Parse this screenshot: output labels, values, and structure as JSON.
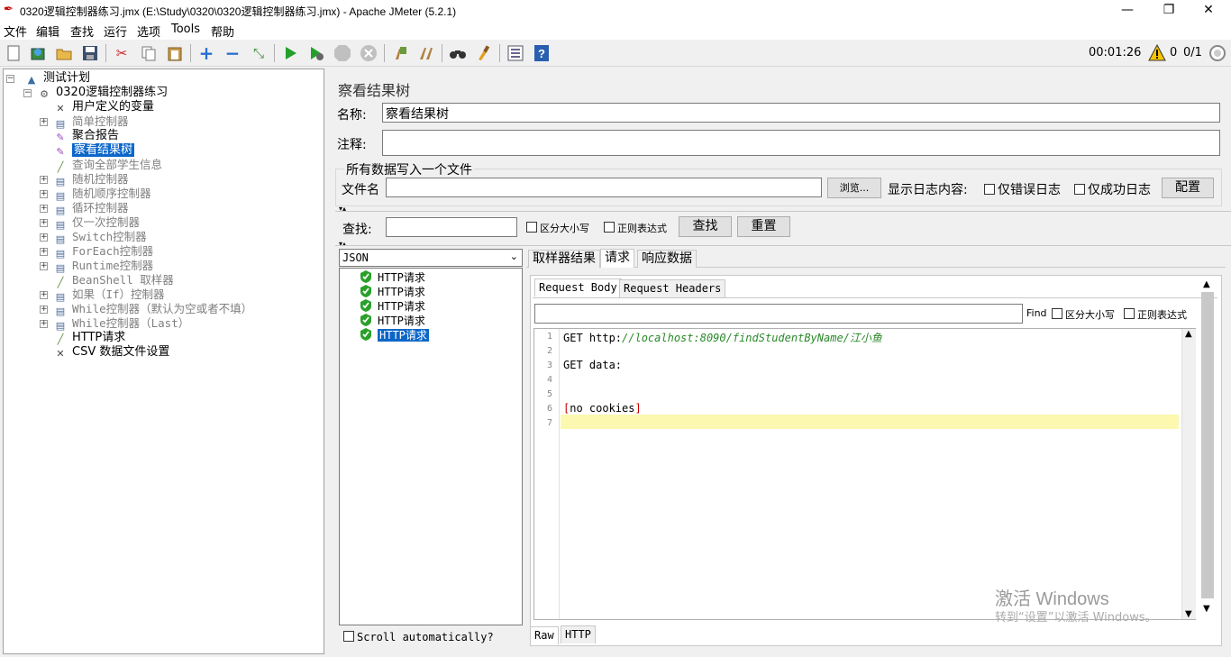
{
  "window": {
    "title": "0320逻辑控制器练习.jmx (E:\\Study\\0320\\0320逻辑控制器练习.jmx) - Apache JMeter (5.2.1)",
    "minimize": "—",
    "restore": "❐",
    "close": "✕"
  },
  "menu": [
    "文件",
    "编辑",
    "查找",
    "运行",
    "选项",
    "Tools",
    "帮助"
  ],
  "toolbar": {
    "icons": [
      "new-icon",
      "templates-icon",
      "open-icon",
      "save-icon",
      "cut-icon",
      "copy-icon",
      "paste-icon",
      "expand-icon",
      "collapse-icon",
      "toggle-icon",
      "start-icon",
      "start-no-pause-icon",
      "stop-icon",
      "shutdown-icon",
      "clear-icon",
      "clear-all-icon",
      "search-icon",
      "reset-search-icon",
      "function-helper-icon",
      "help-icon"
    ],
    "timer": "00:01:26",
    "warning_count": "0",
    "threads": "0/1"
  },
  "tree": [
    {
      "label": "测试计划",
      "level": 0,
      "icon": "test-plan-icon",
      "expandable": true,
      "disabled": false,
      "selected": false
    },
    {
      "label": "0320逻辑控制器练习",
      "level": 1,
      "icon": "thread-group-icon",
      "expandable": true,
      "disabled": false,
      "selected": false
    },
    {
      "label": "用户定义的变量",
      "level": 2,
      "icon": "config-icon",
      "expandable": false,
      "disabled": false,
      "selected": false
    },
    {
      "label": "简单控制器",
      "level": 2,
      "icon": "controller-icon",
      "expandable": true,
      "disabled": true,
      "selected": false
    },
    {
      "label": "聚合报告",
      "level": 2,
      "icon": "listener-icon",
      "expandable": false,
      "disabled": false,
      "selected": false
    },
    {
      "label": "察看结果树",
      "level": 2,
      "icon": "listener-icon",
      "expandable": false,
      "disabled": false,
      "selected": true
    },
    {
      "label": "查询全部学生信息",
      "level": 2,
      "icon": "sampler-icon",
      "expandable": false,
      "disabled": true,
      "selected": false
    },
    {
      "label": "随机控制器",
      "level": 2,
      "icon": "controller-icon",
      "expandable": true,
      "disabled": true,
      "selected": false
    },
    {
      "label": "随机顺序控制器",
      "level": 2,
      "icon": "controller-icon",
      "expandable": true,
      "disabled": true,
      "selected": false
    },
    {
      "label": "循环控制器",
      "level": 2,
      "icon": "controller-icon",
      "expandable": true,
      "disabled": true,
      "selected": false
    },
    {
      "label": "仅一次控制器",
      "level": 2,
      "icon": "controller-icon",
      "expandable": true,
      "disabled": true,
      "selected": false
    },
    {
      "label": "Switch控制器",
      "level": 2,
      "icon": "controller-icon",
      "expandable": true,
      "disabled": true,
      "selected": false
    },
    {
      "label": "ForEach控制器",
      "level": 2,
      "icon": "controller-icon",
      "expandable": true,
      "disabled": true,
      "selected": false
    },
    {
      "label": "Runtime控制器",
      "level": 2,
      "icon": "controller-icon",
      "expandable": true,
      "disabled": true,
      "selected": false
    },
    {
      "label": "BeanShell 取样器",
      "level": 2,
      "icon": "sampler-icon",
      "expandable": false,
      "disabled": true,
      "selected": false
    },
    {
      "label": "如果（If）控制器",
      "level": 2,
      "icon": "controller-icon",
      "expandable": true,
      "disabled": true,
      "selected": false
    },
    {
      "label": "While控制器（默认为空或者不填）",
      "level": 2,
      "icon": "controller-icon",
      "expandable": true,
      "disabled": true,
      "selected": false
    },
    {
      "label": "While控制器（Last）",
      "level": 2,
      "icon": "controller-icon",
      "expandable": true,
      "disabled": true,
      "selected": false
    },
    {
      "label": "HTTP请求",
      "level": 2,
      "icon": "sampler-icon",
      "expandable": false,
      "disabled": false,
      "selected": false
    },
    {
      "label": "CSV 数据文件设置",
      "level": 2,
      "icon": "config-icon",
      "expandable": false,
      "disabled": false,
      "selected": false
    }
  ],
  "panel": {
    "title": "察看结果树",
    "name_label": "名称:",
    "name_value": "察看结果树",
    "comment_label": "注释:",
    "comment_value": "",
    "file_group_title": "所有数据写入一个文件",
    "file_label": "文件名",
    "file_value": "",
    "browse": "浏览...",
    "log_content_label": "显示日志内容:",
    "errors_only": "仅错误日志",
    "success_only": "仅成功日志",
    "configure": "配置",
    "search_label": "查找:",
    "search_value": "",
    "case_sensitive": "区分大小写",
    "regex": "正则表达式",
    "search_button": "查找",
    "reset_button": "重置"
  },
  "results": {
    "renderer": "JSON",
    "items": [
      "HTTP请求",
      "HTTP请求",
      "HTTP请求",
      "HTTP请求",
      "HTTP请求"
    ],
    "selected_index": 4,
    "scroll_auto": "Scroll automatically?"
  },
  "detail": {
    "tabs": [
      "取样器结果",
      "请求",
      "响应数据"
    ],
    "active_tab": "请求",
    "subtabs": [
      "Request Body",
      "Request Headers"
    ],
    "find_label": "Find",
    "find_case": "区分大小写",
    "find_regex": "正则表达式",
    "lines": [
      {
        "n": "1",
        "prefix": "GET http:",
        "url": "//localhost:8090/findStudentByName/江小鱼"
      },
      {
        "n": "2",
        "text": ""
      },
      {
        "n": "3",
        "text": "GET data:"
      },
      {
        "n": "4",
        "text": ""
      },
      {
        "n": "5",
        "text": ""
      },
      {
        "n": "6",
        "text": "[no cookies]"
      },
      {
        "n": "7",
        "text": ""
      }
    ],
    "bottom_tabs": [
      "Raw",
      "HTTP"
    ]
  },
  "watermark": {
    "line1": "激活 Windows",
    "line2": "转到“设置”以激活 Windows。"
  }
}
